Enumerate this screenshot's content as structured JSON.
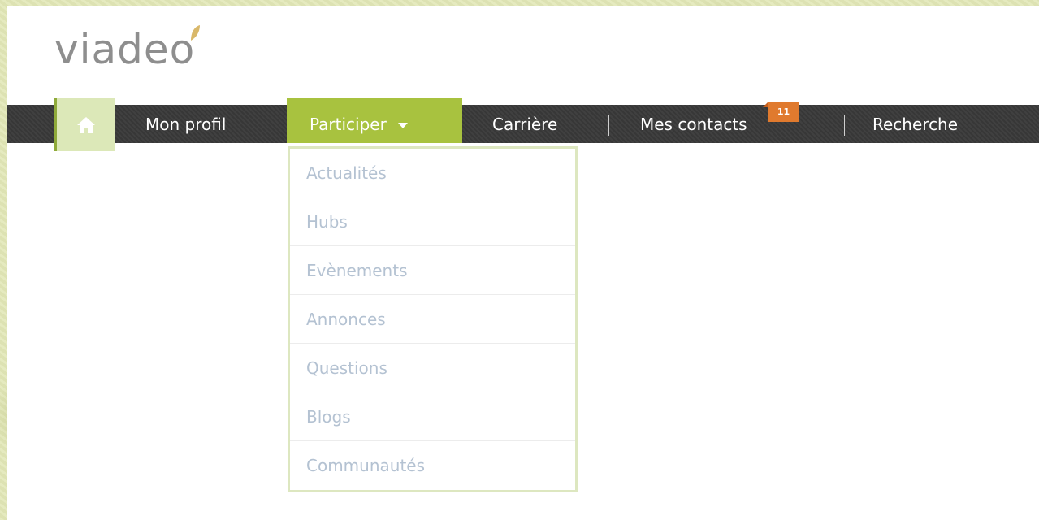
{
  "brand": {
    "logo_text": "viadeo"
  },
  "nav": {
    "home_icon": "home-icon",
    "items": [
      {
        "label": "Mon profil"
      },
      {
        "label": "Participer"
      },
      {
        "label": "Carrière"
      },
      {
        "label": "Mes contacts"
      },
      {
        "label": "Recherche"
      }
    ],
    "active": "Participer",
    "contacts_badge": "11"
  },
  "dropdown": {
    "items": [
      {
        "label": "Actualités"
      },
      {
        "label": "Hubs"
      },
      {
        "label": "Evènements"
      },
      {
        "label": "Annonces"
      },
      {
        "label": "Questions"
      },
      {
        "label": "Blogs"
      },
      {
        "label": "Communautés"
      }
    ]
  },
  "colors": {
    "active_tab": "#a8c23f",
    "navbar": "#3a3a3a",
    "badge": "#e07a2e",
    "dropdown_text": "#b4c2d2",
    "dropdown_border": "#dde7c0",
    "logo_text": "#8e8e8e",
    "logo_leaf": "#d9b86a"
  }
}
